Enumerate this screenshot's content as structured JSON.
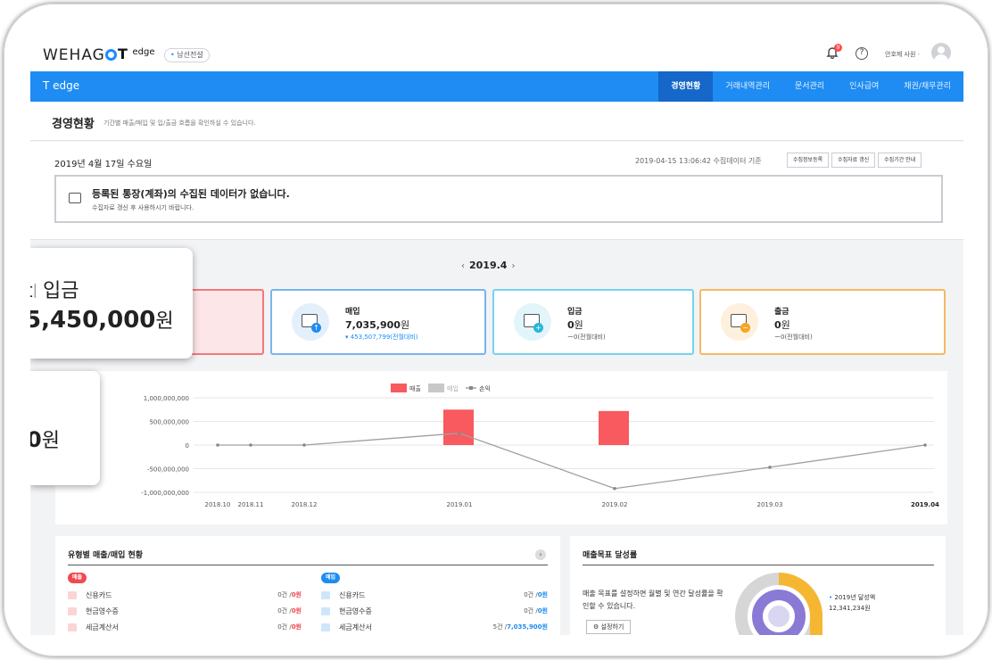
{
  "header": {
    "logo": "WEHAG",
    "logo_tail": "",
    "product_logo": "T",
    "product_logo_small": "edge",
    "company": "남선전설",
    "notification_count": "9",
    "user": "안호제 사원 ·"
  },
  "nav": {
    "title": "T edge",
    "tabs": [
      {
        "label": "경영현황",
        "active": true
      },
      {
        "label": "거래내역관리",
        "active": false
      },
      {
        "label": "문서관리",
        "active": false
      },
      {
        "label": "인사급여",
        "active": false
      },
      {
        "label": "채권/채무관리",
        "active": false
      }
    ]
  },
  "page": {
    "title": "경영현황",
    "description": "기간별 매출/매입 및 입/출금 흐름을 확인하실 수 있습니다."
  },
  "date_section": {
    "date": "2019년 4월 17일 수요일",
    "collect_info": "2019-04-15 13:06:42 수집데이터 기준",
    "buttons": [
      "수집정보등록",
      "수집자료 갱신",
      "수집기간 안내"
    ]
  },
  "notice": {
    "title": "등록된 통장(계좌)의 수집된 데이터가 없습니다.",
    "subtitle": "수집자료 갱신 후 사용하시기 바랍니다."
  },
  "period": {
    "prev": "‹",
    "label": "2019.4",
    "next": "›"
  },
  "cards": [
    {
      "label": "매입",
      "value": "7,035,900",
      "unit": "원",
      "delta": "▾ 453,507,799(전월대비)",
      "color": "#1e8cf2"
    },
    {
      "label": "입금",
      "value": "0",
      "unit": "원",
      "delta": "ー0(전월대비)",
      "color": "#26b8d9"
    },
    {
      "label": "출금",
      "value": "0",
      "unit": "원",
      "delta": "ー0(전월대비)",
      "color": "#f5a623"
    }
  ],
  "zoom": {
    "line1_prefix": "t",
    "line1": "입금",
    "line2_value": "5,450,000",
    "line2_unit": "원",
    "line3_value": "0",
    "line3_unit": "원"
  },
  "chart_data": {
    "type": "bar",
    "categories": [
      "2018.10",
      "2018.11",
      "2018.12",
      "2019.01",
      "2019.02",
      "2019.03",
      "2019.04"
    ],
    "series": [
      {
        "name": "매출",
        "type": "bar",
        "color": "#f85a5f",
        "values": [
          0,
          0,
          0,
          750000000,
          720000000,
          0,
          0
        ]
      },
      {
        "name": "매입",
        "type": "bar",
        "color": "#c8c8c8",
        "values": [
          0,
          0,
          0,
          0,
          0,
          0,
          0
        ]
      },
      {
        "name": "손익",
        "type": "line",
        "color": "#a0a0a0",
        "values": [
          0,
          0,
          0,
          250000000,
          -920000000,
          -470000000,
          0
        ]
      }
    ],
    "yticks": [
      "1,000,000,000",
      "500,000,000",
      "0",
      "-500,000,000",
      "-1,000,000,000"
    ],
    "ylim": [
      -1000000000,
      1000000000
    ],
    "grid": true,
    "legend_position": "top-center"
  },
  "by_type": {
    "title": "유형별 매출/매입 현황",
    "more": "›",
    "sales_tag": "매출",
    "purchase_tag": "매입",
    "sales": [
      {
        "label": "신용카드",
        "count": "0건 /",
        "amount": "0원"
      },
      {
        "label": "현금영수증",
        "count": "0건 /",
        "amount": "0원"
      },
      {
        "label": "세금계산서",
        "count": "0건 /",
        "amount": "0원"
      }
    ],
    "purchases": [
      {
        "label": "신용카드",
        "count": "0건 /",
        "amount": "0원"
      },
      {
        "label": "현금영수증",
        "count": "0건 /",
        "amount": "0원"
      },
      {
        "label": "세금계산서",
        "count": "5건 /",
        "amount": "7,035,900원"
      }
    ]
  },
  "goal": {
    "title": "매출목표 달성률",
    "text": "매출 목표를 설정하면 월별 및 연간 달성률을 확인할 수 있습니다.",
    "button": "설정하기",
    "legend_label": "2019년 달성액",
    "legend_value": "12,341,234원"
  }
}
